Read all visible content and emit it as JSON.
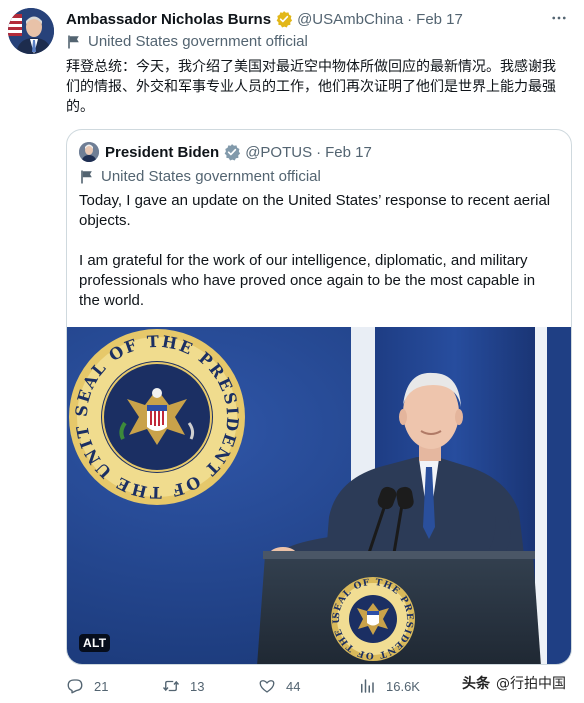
{
  "author": {
    "display_name": "Ambassador Nicholas Burns",
    "handle": "@USAmbChina",
    "separator": "·",
    "date": "Feb 17",
    "gov_label": "United States government official",
    "text": "拜登总统：今天，我介绍了美国对最近空中物体所做回应的最新情况。我感谢我们的情报、外交和军事专业人员的工作，他们再次证明了他们是世界上能力最强的。"
  },
  "quoted": {
    "display_name": "President Biden",
    "handle": "@POTUS",
    "separator": "·",
    "date": "Feb 17",
    "gov_label": "United States government official",
    "paragraph_1": "Today, I gave an update on the United States’ response to recent aerial objects.",
    "paragraph_2": "I am grateful for the work of our intelligence, diplomatic, and military professionals who have proved once again to be the most capable in the world.",
    "alt_badge": "ALT",
    "seal_text": "SEAL OF THE PRESIDENT OF THE UNITED STATES"
  },
  "actions": {
    "replies": "21",
    "retweets": "13",
    "likes": "44",
    "views": "16.6K"
  },
  "watermark": {
    "brand": "头条",
    "account": "@行拍中国"
  },
  "colors": {
    "verified_gold": "#e2b719",
    "gray": "#536471",
    "border": "#cfd9de",
    "backdrop_blue": "#1f3f84"
  },
  "icons": [
    "verified-gold-badge-icon",
    "flag-icon",
    "reply-icon",
    "retweet-icon",
    "like-icon",
    "views-icon",
    "more-icon"
  ]
}
